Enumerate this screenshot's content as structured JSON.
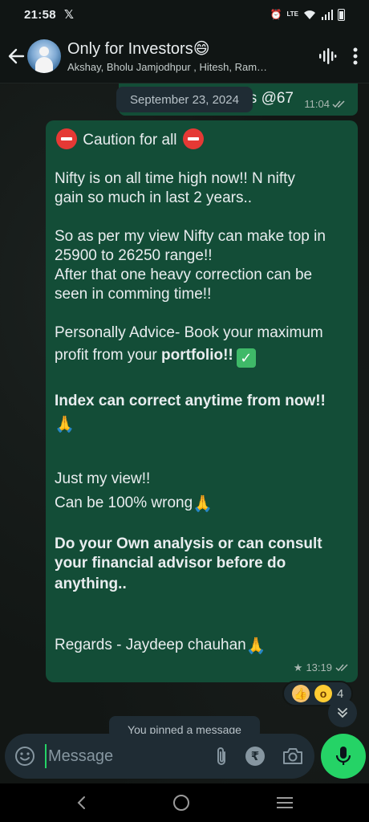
{
  "status_bar": {
    "time": "21:58",
    "app_icon": "x-icon",
    "network": "LTE"
  },
  "header": {
    "group_name": "Only for Investors",
    "group_emoji": "😄",
    "members": "Akshay, Bholu Jamjodhpur , Hitesh, Ram…"
  },
  "previous_message": {
    "text": "s @67",
    "time": "11:04"
  },
  "date_divider": "September 23, 2024",
  "message": {
    "lines": {
      "l1": "Caution for all",
      "l2": "Nifty is on all time high now!! N nifty",
      "l3": "gain so much in last 2 years..",
      "l4": "So as per my view Nifty can make top in",
      "l5": "25900 to 26250 range!!",
      "l6": "After that one heavy correction can be",
      "l7": "seen in comming time!!",
      "l8": "Personally Advice- Book your maximum",
      "l9": "profit from your ",
      "l9_bold": "portfolio!!",
      "l10": "Index can correct anytime from now!!",
      "l11": "Just my view!!",
      "l12": "Can be 100% wrong",
      "l13": "Do your Own analysis or can consult",
      "l14": "your financial advisor before do",
      "l15": "anything..",
      "l16": "Regards - Jaydeep chauhan"
    },
    "time": "13:19",
    "starred": "★"
  },
  "reactions": {
    "count": "4"
  },
  "pinned_note": "You pinned a message",
  "composer": {
    "placeholder": "Message",
    "currency_symbol": "₹"
  }
}
